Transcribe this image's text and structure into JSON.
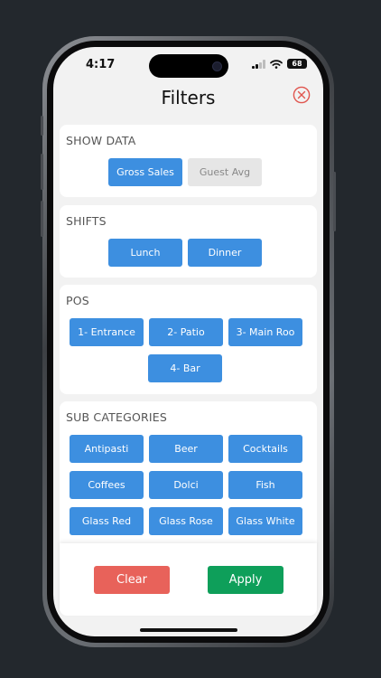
{
  "status": {
    "time": "4:17",
    "battery": "68"
  },
  "header": {
    "title": "Filters"
  },
  "show_data": {
    "label": "SHOW DATA",
    "options": [
      {
        "label": "Gross Sales",
        "selected": true
      },
      {
        "label": "Guest Avg",
        "selected": false
      }
    ]
  },
  "shifts": {
    "label": "SHIFTS",
    "options": [
      {
        "label": "Lunch",
        "selected": true
      },
      {
        "label": "Dinner",
        "selected": true
      }
    ]
  },
  "pos": {
    "label": "POS",
    "options": [
      {
        "label": "1- Entrance"
      },
      {
        "label": "2- Patio"
      },
      {
        "label": "3- Main Roo"
      },
      {
        "label": "4- Bar"
      }
    ]
  },
  "sub_categories": {
    "label": "SUB CATEGORIES",
    "options": [
      {
        "label": "Antipasti"
      },
      {
        "label": "Beer"
      },
      {
        "label": "Cocktails"
      },
      {
        "label": "Coffees"
      },
      {
        "label": "Dolci"
      },
      {
        "label": "Fish"
      },
      {
        "label": "Glass Red"
      },
      {
        "label": "Glass Rose"
      },
      {
        "label": "Glass White"
      }
    ]
  },
  "actions": {
    "clear_label": "Clear",
    "apply_label": "Apply",
    "clear_color": "#e8625a",
    "apply_color": "#0e9f5a"
  },
  "colors": {
    "accent": "#3d8fe0",
    "close_icon": "#e0554e"
  }
}
